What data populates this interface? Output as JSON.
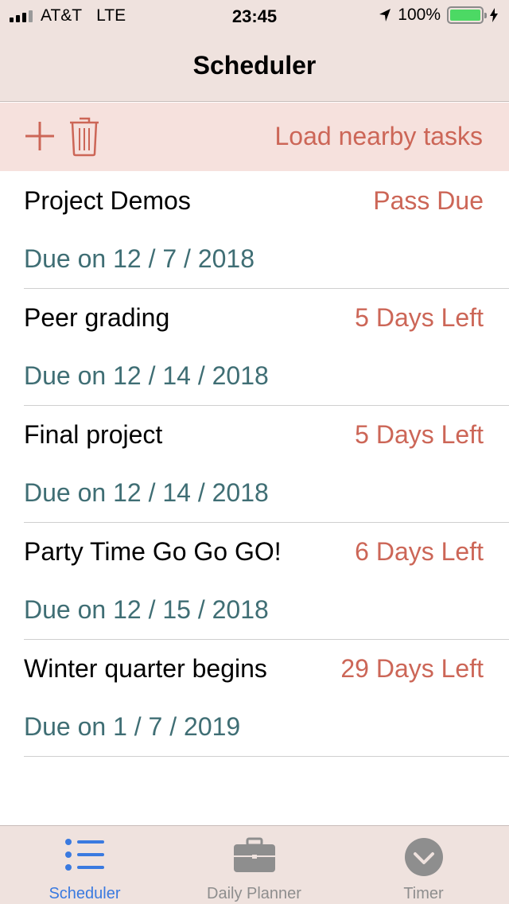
{
  "status_bar": {
    "carrier": "AT&T",
    "network": "LTE",
    "time": "23:45",
    "battery": "100%"
  },
  "nav": {
    "title": "Scheduler"
  },
  "toolbar": {
    "load_label": "Load nearby tasks"
  },
  "tasks": [
    {
      "title": "Project Demos",
      "remaining": "Pass Due",
      "due": "Due on 12 / 7 / 2018"
    },
    {
      "title": "Peer grading",
      "remaining": "5 Days Left",
      "due": "Due on 12 / 14 / 2018"
    },
    {
      "title": "Final project",
      "remaining": "5 Days Left",
      "due": "Due on 12 / 14 / 2018"
    },
    {
      "title": "Party Time Go Go GO!",
      "remaining": "6 Days Left",
      "due": "Due on 12 / 15 / 2018"
    },
    {
      "title": "Winter quarter begins",
      "remaining": "29 Days Left",
      "due": "Due on 1 / 7 / 2019"
    }
  ],
  "tabs": [
    {
      "label": "Scheduler",
      "icon": "list-icon",
      "active": true
    },
    {
      "label": "Daily Planner",
      "icon": "briefcase-icon",
      "active": false
    },
    {
      "label": "Timer",
      "icon": "checkmark-circle-icon",
      "active": false
    }
  ],
  "colors": {
    "accent": "#cc6657",
    "due_text": "#3f6e74",
    "bar_bg": "#efe2de",
    "toolbar_bg": "#f6e1dd",
    "tab_active": "#3a7ae0",
    "tab_inactive": "#8e8e8e"
  }
}
